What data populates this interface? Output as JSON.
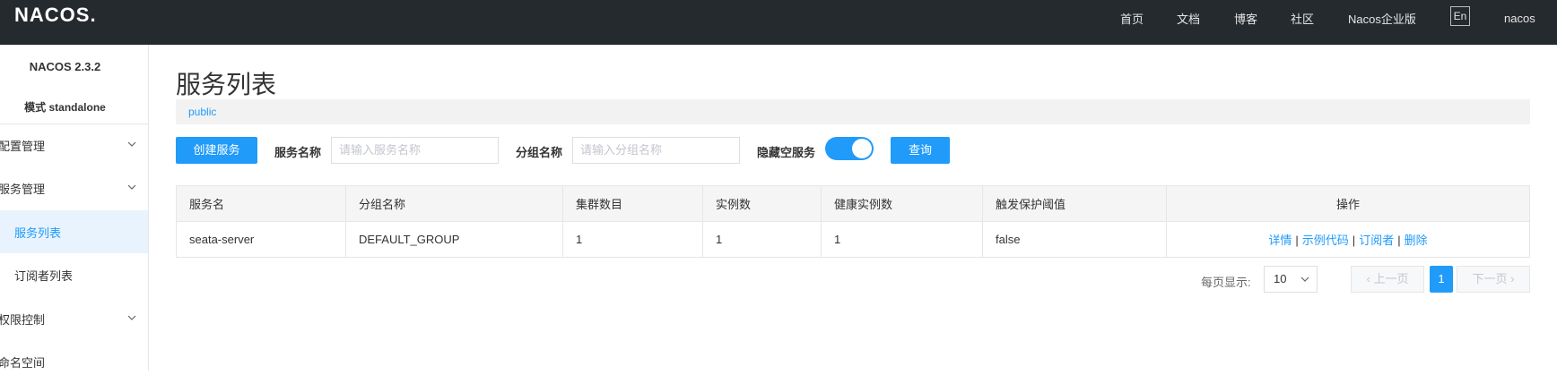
{
  "topbar": {
    "logo": "NACOS.",
    "nav": [
      "首页",
      "文档",
      "博客",
      "社区",
      "Nacos企业版"
    ],
    "lang": "En",
    "user": "nacos"
  },
  "sidebar": {
    "version": "NACOS 2.3.2",
    "mode": "模式 standalone",
    "menu": [
      {
        "label": "配置管理"
      },
      {
        "label": "服务管理"
      },
      {
        "label": "服务列表"
      },
      {
        "label": "订阅者列表"
      },
      {
        "label": "权限控制"
      },
      {
        "label": "命名空间"
      }
    ]
  },
  "main": {
    "title": "服务列表",
    "namespace": "public",
    "create_button": "创建服务",
    "service_name_label": "服务名称",
    "service_name_placeholder": "请输入服务名称",
    "group_name_label": "分组名称",
    "group_name_placeholder": "请输入分组名称",
    "hide_empty_label": "隐藏空服务",
    "hide_empty_on": true,
    "query_button": "查询"
  },
  "table": {
    "headers": [
      "服务名",
      "分组名称",
      "集群数目",
      "实例数",
      "健康实例数",
      "触发保护阈值",
      "操作"
    ],
    "rows": [
      {
        "service": "seata-server",
        "group": "DEFAULT_GROUP",
        "clusters": "1",
        "instances": "1",
        "healthy": "1",
        "threshold": "false",
        "ops": [
          "详情",
          "示例代码",
          "订阅者",
          "删除"
        ]
      }
    ]
  },
  "pagination": {
    "page_size_label": "每页显示:",
    "page_size": "10",
    "prev": "上一页",
    "current": "1",
    "next": "下一页"
  },
  "colors": {
    "accent": "#209bfa",
    "topbar": "#252a2f"
  }
}
